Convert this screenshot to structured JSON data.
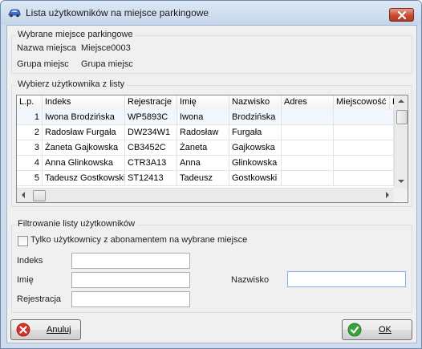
{
  "window": {
    "title": "Lista użytkowników na miejsce parkingowe"
  },
  "selected_place": {
    "group_title": "Wybrane miejsce parkingowe",
    "name_label": "Nazwa miejsca",
    "name_value": "Miejsce0003",
    "group_label": "Grupa miejsc",
    "group_value": "Grupa miejsc"
  },
  "users": {
    "group_title": "Wybierz użytkownika z listy",
    "columns": [
      "L.p.",
      "Indeks",
      "Rejestracje",
      "Imię",
      "Nazwisko",
      "Adres",
      "Miejscowość",
      "K"
    ],
    "rows": [
      [
        "1",
        "Iwona Brodzińska",
        "WP5893C",
        "Iwona",
        "Brodzińska",
        "",
        ""
      ],
      [
        "2",
        "Radosław Furgała",
        "DW234W1",
        "Radosław",
        "Furgała",
        "",
        ""
      ],
      [
        "3",
        "Żaneta Gajkowska",
        "CB3452C",
        "Żaneta",
        "Gajkowska",
        "",
        ""
      ],
      [
        "4",
        "Anna Glinkowska",
        "CTR3A13",
        "Anna",
        "Glinkowska",
        "",
        ""
      ],
      [
        "5",
        "Tadeusz Gostkowski",
        "ST12413",
        "Tadeusz",
        "Gostkowski",
        "",
        ""
      ]
    ]
  },
  "filter": {
    "group_title": "Filtrowanie listy użytkowników",
    "checkbox_label": "Tylko użytkownicy z abonamentem na wybrane miejsce",
    "checkbox_checked": false,
    "index_label": "Indeks",
    "index_value": "",
    "first_name_label": "Imię",
    "first_name_value": "",
    "surname_label": "Nazwisko",
    "surname_value": "",
    "registration_label": "Rejestracja",
    "registration_value": ""
  },
  "buttons": {
    "cancel": "Anuluj",
    "ok": "OK"
  },
  "colors": {
    "accent_focus": "#7eb4ea",
    "cancel_icon": "#d9312a",
    "ok_icon": "#3aa33a",
    "close_button": "#c84a33"
  },
  "icons": {
    "app": "car-icon",
    "close": "close-icon",
    "cancel": "cancel-icon",
    "ok": "ok-check-icon"
  }
}
